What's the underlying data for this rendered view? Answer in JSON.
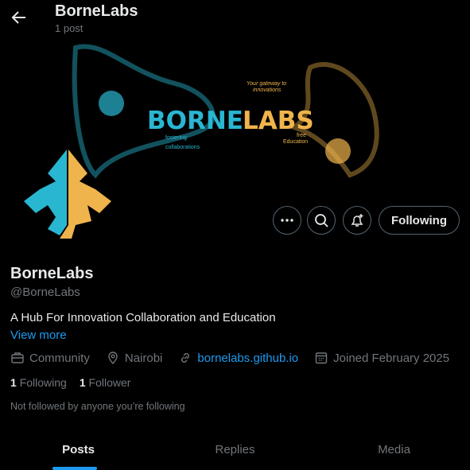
{
  "header": {
    "title": "BorneLabs",
    "post_count": "1 post"
  },
  "banner": {
    "brand_left": "BORNE",
    "brand_right": "LABS",
    "tagline_top": [
      "Your gateway to",
      "innovations"
    ],
    "tagline_left": [
      "fostering",
      "collaborations"
    ],
    "tagline_right": [
      "free",
      "Education"
    ],
    "colors": {
      "cyan": "#29b6d1",
      "gold": "#f0b44c"
    }
  },
  "actions": {
    "following_label": "Following"
  },
  "profile": {
    "name": "BorneLabs",
    "handle": "@BorneLabs",
    "bio": "A Hub For Innovation Collaboration and Education",
    "view_more": "View more",
    "category": "Community",
    "location": "Nairobi",
    "website": "bornelabs.github.io",
    "joined": "Joined February 2025",
    "following_count": "1",
    "following_label": "Following",
    "followers_count": "1",
    "followers_label": "Follower",
    "note": "Not followed by anyone you’re following"
  },
  "tabs": [
    {
      "label": "Posts",
      "active": true
    },
    {
      "label": "Replies"
    },
    {
      "label": "Media"
    }
  ],
  "accent": "#1d9bf0"
}
